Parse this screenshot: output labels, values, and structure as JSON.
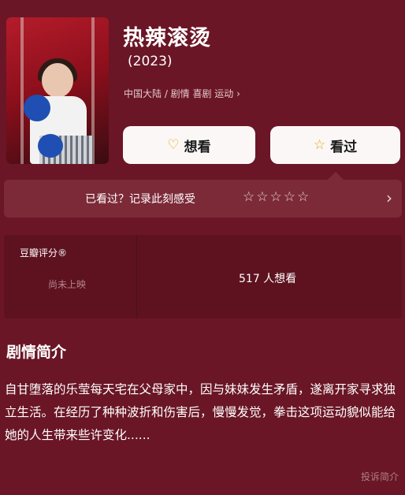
{
  "movie": {
    "title": "热辣滚烫",
    "year": "(2023)",
    "meta": "中国大陆 / 剧情 喜剧 运动 ›"
  },
  "actions": {
    "want_label": "想看",
    "seen_label": "看过",
    "want_icon": "heart-plus-icon",
    "seen_icon": "star-outline-icon"
  },
  "record": {
    "text": "已看过？记录此刻感受",
    "stars": [
      "☆",
      "☆",
      "☆",
      "☆",
      "☆"
    ],
    "arrow": "›"
  },
  "rating": {
    "label": "豆瓣评分®",
    "status": "尚未上映",
    "want_count": "517 人想看"
  },
  "summary": {
    "heading": "剧情简介",
    "text": "自甘堕落的乐莹每天宅在父母家中，因与妹妹发生矛盾，遂离开家寻求独立生活。在经历了种种波折和伤害后，慢慢发觉，拳击这项运动貌似能给她的人生带来些许变化......",
    "report": "投诉简介"
  },
  "colors": {
    "background": "#6a1626",
    "button": "#fbf7f6",
    "accent_star": "#e5a600"
  }
}
